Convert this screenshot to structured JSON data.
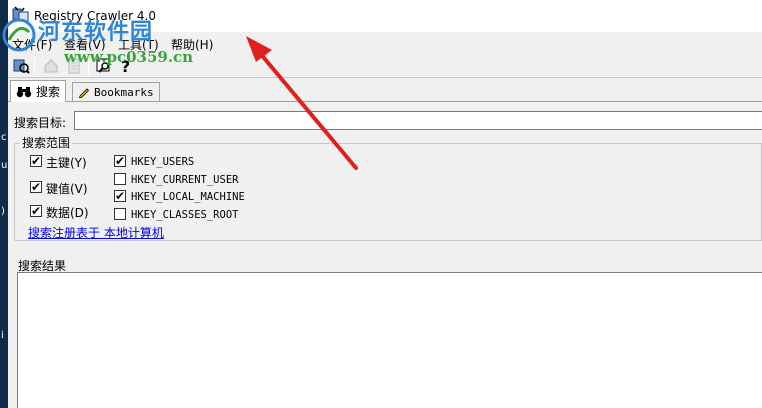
{
  "window": {
    "title": "Registry Crawler 4.0"
  },
  "watermark": {
    "site_name": "河东软件园",
    "url": "www.pc0359.cn"
  },
  "menu": [
    "文件(F)",
    "查看(V)",
    "工具(T)",
    "帮助(H)"
  ],
  "toolbar": {
    "buttons": [
      "search-run-icon",
      "home-icon",
      "document-icon",
      "find-icon",
      "help-icon"
    ]
  },
  "tabs": [
    {
      "label": "搜索",
      "active": true
    },
    {
      "label": "Bookmarks",
      "active": false
    }
  ],
  "search": {
    "target_label": "搜索目标:",
    "target_value": ""
  },
  "scope": {
    "legend": "搜索范围",
    "options": [
      {
        "label": "主键(Y)",
        "checked": true
      },
      {
        "label": "键值(V)",
        "checked": true
      },
      {
        "label": "数据(D)",
        "checked": true
      }
    ],
    "hives": [
      {
        "label": "HKEY_USERS",
        "checked": true
      },
      {
        "label": "HKEY_CURRENT_USER",
        "checked": false
      },
      {
        "label": "HKEY_LOCAL_MACHINE",
        "checked": true
      },
      {
        "label": "HKEY_CLASSES_ROOT",
        "checked": false
      }
    ],
    "link": "搜索注册表于 本地计算机"
  },
  "results": {
    "label": "搜索结果"
  },
  "colors": {
    "arrow": "#e02020",
    "link": "#0000ee",
    "watermark_blue": "#2f86d6",
    "watermark_green": "#3aa43a"
  }
}
